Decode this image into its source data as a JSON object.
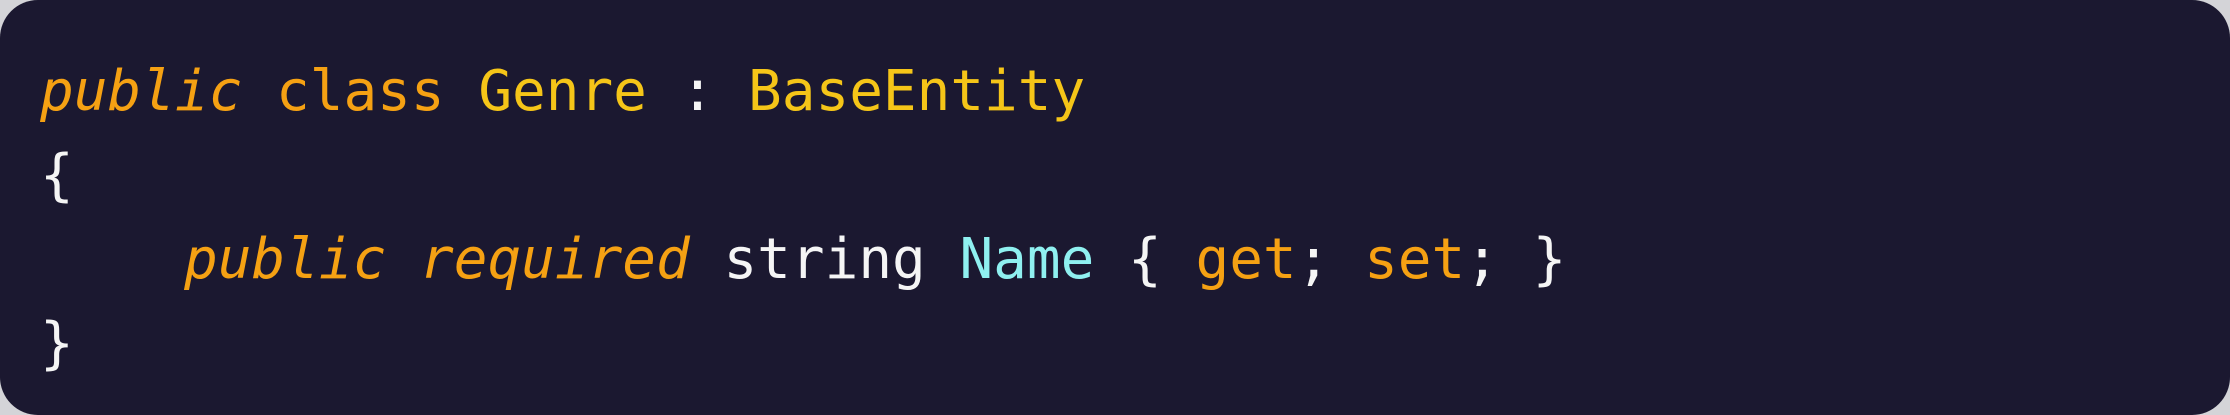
{
  "code": {
    "line1": {
      "modifier": "public",
      "keyword": "class",
      "class_name": "Genre",
      "colon": ":",
      "base_type": "BaseEntity"
    },
    "line2": {
      "open_brace": "{"
    },
    "line3": {
      "modifier": "public",
      "modifier2": "required",
      "type": "string",
      "property_name": "Name",
      "open_brace": "{",
      "get": "get",
      "semi1": ";",
      "set": "set",
      "semi2": ";",
      "close_brace": "}"
    },
    "line4": {
      "close_brace": "}"
    }
  },
  "colors": {
    "background": "#1b1830",
    "keyword": "#f5a113",
    "type": "#f5c518",
    "identifier": "#8ff0f0",
    "text": "#f5f5f5"
  }
}
